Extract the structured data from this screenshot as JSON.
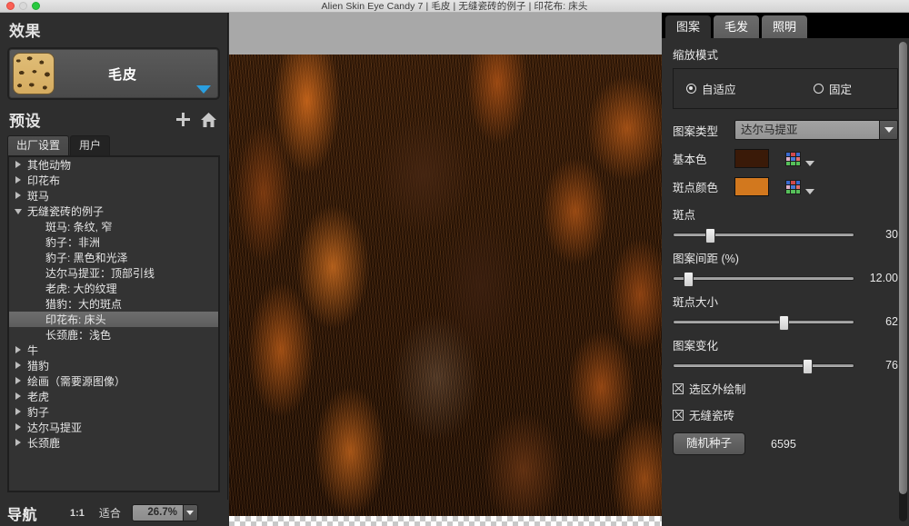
{
  "window": {
    "title": "Alien Skin Eye Candy 7 | 毛皮 | 无缝瓷砖的例子 | 印花布: 床头",
    "controls": {
      "close": "close",
      "minimize": "minimize",
      "zoom": "zoom"
    }
  },
  "left": {
    "effects_heading": "效果",
    "effect_name": "毛皮",
    "presets_heading": "预设",
    "add_label": "+",
    "home_label": "home",
    "tabs": [
      {
        "label": "出厂设置",
        "active": true
      },
      {
        "label": "用户",
        "active": false
      }
    ],
    "tree": [
      {
        "label": "其他动物",
        "state": "closed",
        "depth": 0,
        "selected": false
      },
      {
        "label": "印花布",
        "state": "closed",
        "depth": 0,
        "selected": false
      },
      {
        "label": "斑马",
        "state": "closed",
        "depth": 0,
        "selected": false
      },
      {
        "label": "无缝瓷砖的例子",
        "state": "open",
        "depth": 0,
        "selected": false
      },
      {
        "label": "斑马: 条纹, 窄",
        "state": "none",
        "depth": 1,
        "selected": false
      },
      {
        "label": "豹子：非洲",
        "state": "none",
        "depth": 1,
        "selected": false
      },
      {
        "label": "豹子: 黑色和光泽",
        "state": "none",
        "depth": 1,
        "selected": false
      },
      {
        "label": "达尔马提亚：顶部引线",
        "state": "none",
        "depth": 1,
        "selected": false
      },
      {
        "label": "老虎: 大的纹理",
        "state": "none",
        "depth": 1,
        "selected": false
      },
      {
        "label": "猎豹：大的斑点",
        "state": "none",
        "depth": 1,
        "selected": false
      },
      {
        "label": "印花布: 床头",
        "state": "none",
        "depth": 1,
        "selected": true
      },
      {
        "label": "长颈鹿：浅色",
        "state": "none",
        "depth": 1,
        "selected": false
      },
      {
        "label": "牛",
        "state": "closed",
        "depth": 0,
        "selected": false
      },
      {
        "label": "猎豹",
        "state": "closed",
        "depth": 0,
        "selected": false
      },
      {
        "label": "绘画（需要源图像）",
        "state": "closed",
        "depth": 0,
        "selected": false
      },
      {
        "label": "老虎",
        "state": "closed",
        "depth": 0,
        "selected": false
      },
      {
        "label": "豹子",
        "state": "closed",
        "depth": 0,
        "selected": false
      },
      {
        "label": "达尔马提亚",
        "state": "closed",
        "depth": 0,
        "selected": false
      },
      {
        "label": "长颈鹿",
        "state": "closed",
        "depth": 0,
        "selected": false
      }
    ],
    "footer": {
      "nav_label": "导航",
      "ratio_label": "1:1",
      "fit_label": "适合",
      "zoom_value": "26.7%"
    }
  },
  "right": {
    "tabs": [
      {
        "label": "图案",
        "active": true
      },
      {
        "label": "毛发",
        "active": false
      },
      {
        "label": "照明",
        "active": false
      }
    ],
    "scale_mode": {
      "heading": "缩放模式",
      "options": [
        {
          "label": "自适应",
          "selected": true
        },
        {
          "label": "固定",
          "selected": false
        }
      ]
    },
    "pattern_type": {
      "label": "图案类型",
      "value": "达尔马提亚"
    },
    "base_color": {
      "label": "基本色",
      "hex": "#3a1a08"
    },
    "spot_color": {
      "label": "斑点颜色",
      "hex": "#d2781e"
    },
    "sliders": [
      {
        "label": "斑点",
        "value": "30",
        "percent": 20
      },
      {
        "label": "图案间距 (%)",
        "value": "12.00",
        "percent": 8
      },
      {
        "label": "斑点大小",
        "value": "62",
        "percent": 61
      },
      {
        "label": "图案变化",
        "value": "76",
        "percent": 74
      }
    ],
    "checkboxes": [
      {
        "label": "选区外绘制",
        "checked": true
      },
      {
        "label": "无缝瓷砖",
        "checked": true
      }
    ],
    "seed": {
      "button_label": "随机种子",
      "value": "6595"
    }
  },
  "colors": {
    "panel_bg": "#2e2e2e",
    "accent_blue": "#2a9fe0",
    "selection_gray": "#6d6d6d",
    "canvas_band": "#a8a8a8"
  }
}
